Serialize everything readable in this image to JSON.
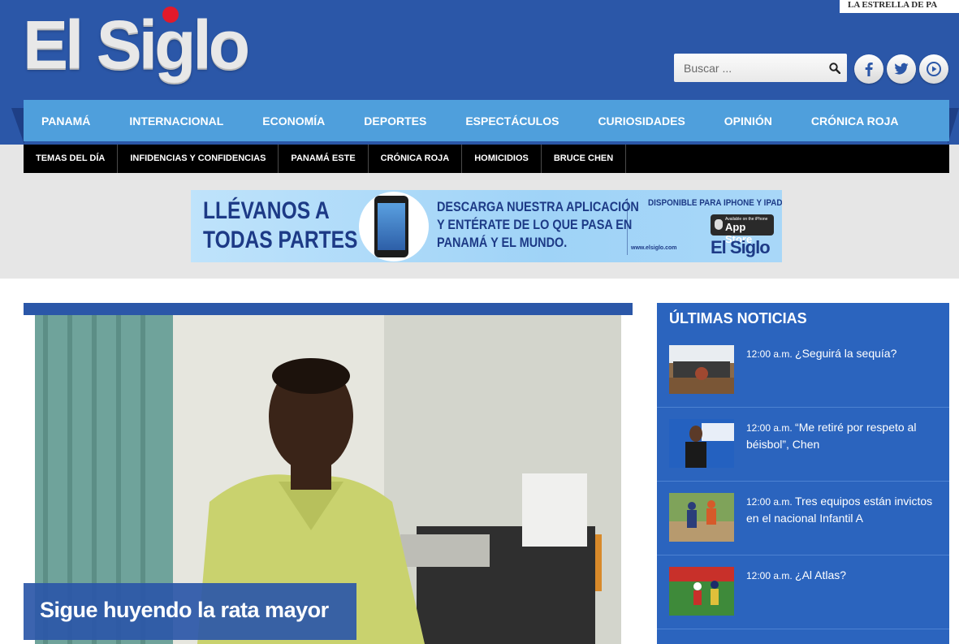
{
  "header": {
    "logo_text": "El Siglo",
    "partner_text": "LA ESTRELLA DE PA"
  },
  "search": {
    "placeholder": "Buscar ...",
    "icon": "search-icon"
  },
  "social": [
    {
      "name": "facebook",
      "icon": "facebook-icon"
    },
    {
      "name": "twitter",
      "icon": "twitter-icon"
    },
    {
      "name": "youtube",
      "icon": "play-icon"
    }
  ],
  "main_nav": [
    "PANAMÁ",
    "INTERNACIONAL",
    "ECONOMÍA",
    "DEPORTES",
    "ESPECTÁCULOS",
    "CURIOSIDADES",
    "OPINIÓN",
    "CRÓNICA ROJA"
  ],
  "sub_nav": [
    "TEMAS DEL DÍA",
    "INFIDENCIAS Y CONFIDENCIAS",
    "PANAMÁ ESTE",
    "CRÓNICA ROJA",
    "HOMICIDIOS",
    "BRUCE CHEN"
  ],
  "banner": {
    "headline_1": "LLÉVANOS A",
    "headline_2": "TODAS PARTES",
    "mid_1": "DESCARGA NUESTRA APLICACIÓN",
    "mid_2": "Y ENTÉRATE DE LO QUE PASA EN",
    "mid_3": "PANAMÁ Y EL MUNDO.",
    "availability": "DISPONIBLE PARA IPHONE Y IPAD .",
    "store_small": "Available on the iPhone",
    "store_big": "App Store",
    "url": "www.elsiglo.com",
    "logo": "El Siglo"
  },
  "feature": {
    "headline": "Sigue huyendo la rata mayor"
  },
  "sidebar": {
    "title": "ÚLTIMAS NOTICIAS",
    "items": [
      {
        "time": "12:00 a.m.",
        "title": "¿Seguirá la sequía?"
      },
      {
        "time": "12:00 a.m.",
        "title": "“Me retiré por respeto al béisbol”, Chen"
      },
      {
        "time": "12:00 a.m.",
        "title": "Tres equipos están invictos en el nacional Infantil A"
      },
      {
        "time": "12:00 a.m.",
        "title": "¿Al Atlas?"
      }
    ]
  },
  "colors": {
    "header_blue": "#2b57a8",
    "nav_blue": "#4f9fdc",
    "sidebar_blue": "#2b64be",
    "logo_red_dot": "#e11a2b"
  }
}
